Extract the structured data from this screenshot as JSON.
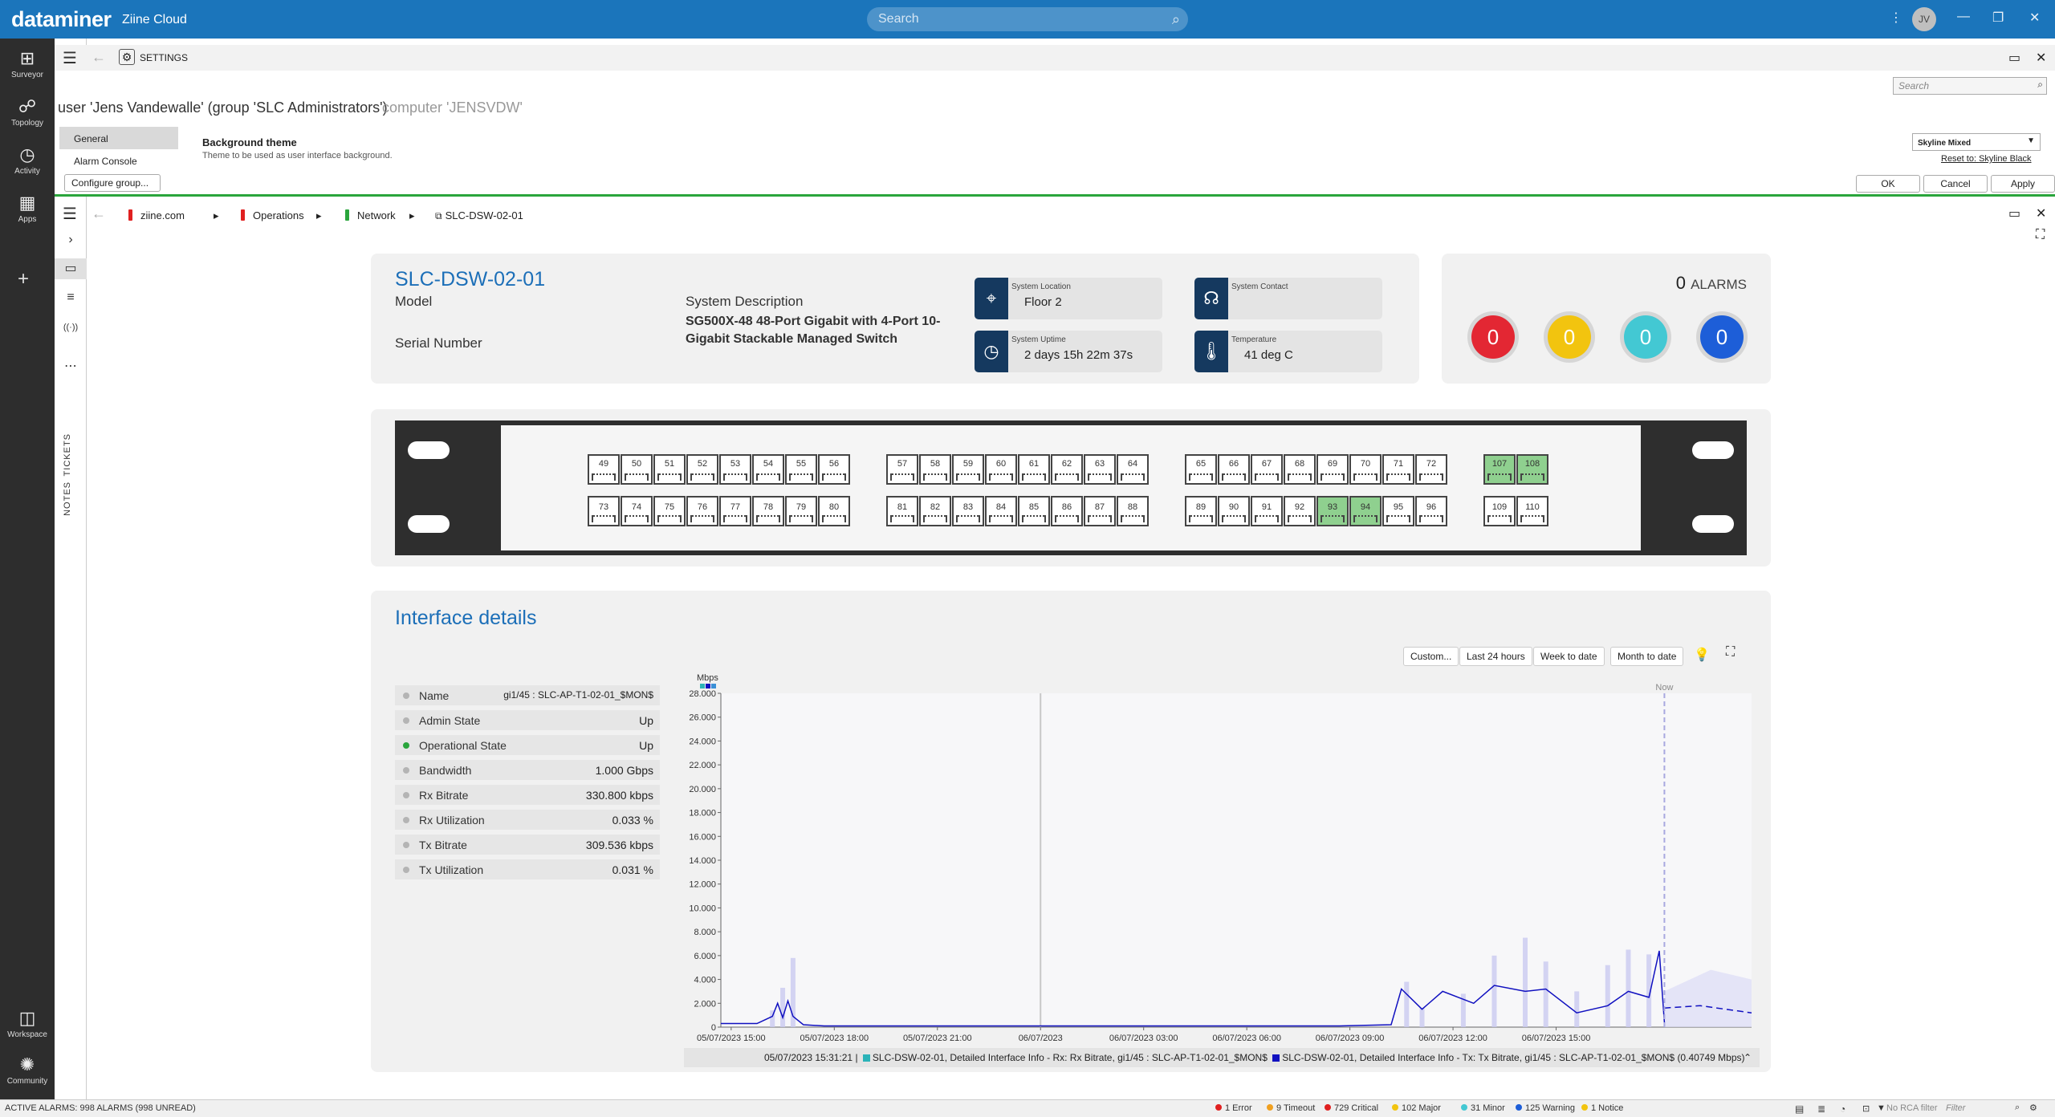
{
  "app": {
    "logo": "dataminer",
    "subtitle": "Ziine Cloud",
    "search_placeholder": "Search",
    "user_initials": "JV"
  },
  "rail": {
    "items": [
      {
        "label": "Surveyor",
        "icon": "surveyor-icon"
      },
      {
        "label": "Topology",
        "icon": "topology-icon"
      },
      {
        "label": "Activity",
        "icon": "activity-icon"
      },
      {
        "label": "Apps",
        "icon": "apps-icon"
      }
    ],
    "bottom": [
      {
        "label": "Workspace",
        "icon": "workspace-icon"
      },
      {
        "label": "Community",
        "icon": "community-icon"
      }
    ]
  },
  "side_tabs": {
    "tickets": "TICKETS",
    "notes": "NOTES"
  },
  "settings": {
    "title": "SETTINGS",
    "user_line": "user 'Jens Vandewalle' (group 'SLC Administrators')",
    "computer_line": "computer 'JENSVDW'",
    "search_placeholder": "Search",
    "nav": [
      {
        "label": "General",
        "active": true
      },
      {
        "label": "Alarm Console",
        "active": false
      }
    ],
    "configure_group": "Configure group...",
    "background_theme_title": "Background theme",
    "background_theme_desc": "Theme to be used as user interface background.",
    "theme_value": "Skyline Mixed",
    "reset_to": "Reset to:",
    "reset_value": "Skyline Black",
    "buttons": {
      "ok": "OK",
      "cancel": "Cancel",
      "apply": "Apply"
    }
  },
  "breadcrumb": [
    {
      "label": "ziine.com",
      "color": "#e02020"
    },
    {
      "label": "Operations",
      "color": "#e02020"
    },
    {
      "label": "Network",
      "color": "#2aa53c"
    },
    {
      "label": "SLC-DSW-02-01",
      "icon": "element-icon"
    }
  ],
  "device": {
    "name": "SLC-DSW-02-01",
    "model_label": "Model",
    "serial_label": "Serial Number",
    "sysdesc_label": "System Description",
    "sysdesc_value": "SG500X-48 48-Port Gigabit with 4-Port 10-Gigabit Stackable Managed Switch",
    "tiles": [
      {
        "label": "System Location",
        "value": "Floor 2",
        "icon": "location-pin-icon"
      },
      {
        "label": "System Contact",
        "value": "",
        "icon": "headset-icon"
      },
      {
        "label": "System Uptime",
        "value": "2 days 15h 22m 37s",
        "icon": "clock-icon"
      },
      {
        "label": "Temperature",
        "value": "41 deg C",
        "icon": "thermometer-icon"
      }
    ]
  },
  "alarms": {
    "total": "0",
    "label": "ALARMS",
    "bubbles": [
      {
        "value": "0",
        "color": "#e32733",
        "severity": "critical"
      },
      {
        "value": "0",
        "color": "#f2c40f",
        "severity": "major"
      },
      {
        "value": "0",
        "color": "#43c8d3",
        "severity": "minor"
      },
      {
        "value": "0",
        "color": "#1d5ed8",
        "severity": "warning"
      }
    ]
  },
  "switch": {
    "groups": [
      {
        "top": [
          "49",
          "50",
          "51",
          "52",
          "53",
          "54",
          "55",
          "56"
        ],
        "bottom": [
          "73",
          "74",
          "75",
          "76",
          "77",
          "78",
          "79",
          "80"
        ],
        "up": []
      },
      {
        "top": [
          "57",
          "58",
          "59",
          "60",
          "61",
          "62",
          "63",
          "64"
        ],
        "bottom": [
          "81",
          "82",
          "83",
          "84",
          "85",
          "86",
          "87",
          "88"
        ],
        "up": []
      },
      {
        "top": [
          "65",
          "66",
          "67",
          "68",
          "69",
          "70",
          "71",
          "72"
        ],
        "bottom": [
          "89",
          "90",
          "91",
          "92",
          "93",
          "94",
          "95",
          "96"
        ],
        "up": [
          "93",
          "94"
        ]
      },
      {
        "top": [
          "107",
          "108"
        ],
        "bottom": [
          "109",
          "110"
        ],
        "up": [
          "107",
          "108"
        ]
      }
    ]
  },
  "interface": {
    "title": "Interface details",
    "ranges": [
      "Custom...",
      "Last 24 hours",
      "Week to date",
      "Month to date"
    ],
    "props": [
      {
        "key": "Name",
        "value": "gi1/45 : SLC-AP-T1-02-01_$MON$",
        "status": "grey"
      },
      {
        "key": "Admin State",
        "value": "Up",
        "status": "grey"
      },
      {
        "key": "Operational State",
        "value": "Up",
        "status": "green"
      },
      {
        "key": "Bandwidth",
        "value": "1.000 Gbps",
        "status": "grey"
      },
      {
        "key": "Rx Bitrate",
        "value": "330.800 kbps",
        "status": "grey"
      },
      {
        "key": "Rx Utilization",
        "value": "0.033 %",
        "status": "grey"
      },
      {
        "key": "Tx Bitrate",
        "value": "309.536 kbps",
        "status": "grey"
      },
      {
        "key": "Tx Utilization",
        "value": "0.031 %",
        "status": "grey"
      }
    ],
    "legend_time": "05/07/2023 15:31:21 |",
    "legend_rx": "SLC-DSW-02-01, Detailed Interface Info - Rx: Rx Bitrate, gi1/45 : SLC-AP-T1-02-01_$MON$",
    "legend_tx": "SLC-DSW-02-01, Detailed Interface Info - Tx: Tx Bitrate, gi1/45 : SLC-AP-T1-02-01_$MON$ (0.40749 Mbps)"
  },
  "chart_data": {
    "type": "line",
    "ylabel": "Mbps",
    "ylim": [
      0,
      28000
    ],
    "yticks": [
      "0",
      "2.000",
      "4.000",
      "6.000",
      "8.000",
      "10.000",
      "12.000",
      "14.000",
      "16.000",
      "18.000",
      "20.000",
      "22.000",
      "24.000",
      "26.000",
      "28.000"
    ],
    "xticks": [
      "05/07/2023 15:00",
      "05/07/2023 18:00",
      "05/07/2023 21:00",
      "06/07/2023",
      "06/07/2023 03:00",
      "06/07/2023 06:00",
      "06/07/2023 09:00",
      "06/07/2023 12:00",
      "06/07/2023 15:00"
    ],
    "now_label": "Now",
    "series": [
      {
        "color": "#1010c0",
        "points": [
          [
            0,
            300
          ],
          [
            0.35,
            300
          ],
          [
            0.5,
            900
          ],
          [
            0.55,
            2000
          ],
          [
            0.6,
            800
          ],
          [
            0.65,
            2200
          ],
          [
            0.7,
            900
          ],
          [
            0.8,
            200
          ],
          [
            1,
            100
          ],
          [
            3,
            100
          ],
          [
            6,
            100
          ],
          [
            6.5,
            200
          ],
          [
            6.6,
            3200
          ],
          [
            6.8,
            1500
          ],
          [
            7,
            3000
          ],
          [
            7.3,
            2000
          ],
          [
            7.5,
            3500
          ],
          [
            7.8,
            3000
          ],
          [
            8.0,
            3200
          ],
          [
            8.3,
            1200
          ],
          [
            8.6,
            1800
          ],
          [
            8.8,
            3000
          ],
          [
            9.0,
            2500
          ],
          [
            9.1,
            6400
          ],
          [
            9.15,
            400
          ]
        ]
      },
      {
        "color": "#1010c0",
        "dashed": true,
        "points": [
          [
            9.15,
            1600
          ],
          [
            9.5,
            1800
          ],
          [
            10,
            1200
          ]
        ]
      }
    ]
  },
  "status": {
    "active_alarms": "ACTIVE ALARMS: 998 ALARMS (998 UNREAD)",
    "counts": [
      {
        "label": "1 Error",
        "color": "#e02020"
      },
      {
        "label": "9 Timeout",
        "color": "#f0a020"
      },
      {
        "label": "729 Critical",
        "color": "#e02020"
      },
      {
        "label": "102 Major",
        "color": "#f2c40f"
      },
      {
        "label": "31 Minor",
        "color": "#43c8d3"
      },
      {
        "label": "125 Warning",
        "color": "#1d5ed8"
      },
      {
        "label": "1 Notice",
        "color": "#f2c40f"
      }
    ],
    "rca": "No RCA filter",
    "filter_placeholder": "Filter"
  }
}
